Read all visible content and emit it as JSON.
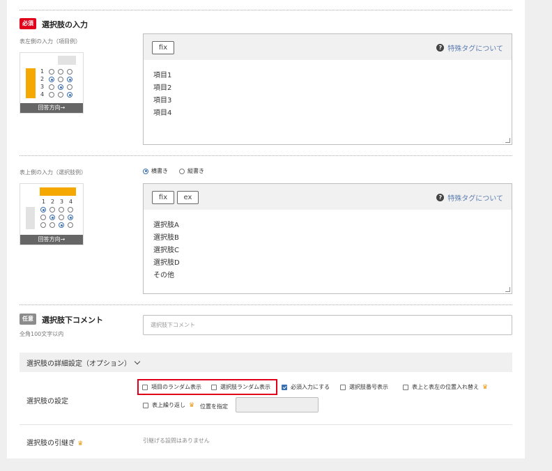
{
  "section1": {
    "badge": "必須",
    "badge_color": "#e0001b",
    "title": "選択肢の入力",
    "sublabel": "表左側の入力（項目例）",
    "illustration_numbers": [
      "1",
      "2",
      "3",
      "4"
    ],
    "illustration_footer": "回答方向→",
    "buttons": [
      "fix"
    ],
    "help_text": "特殊タグについて",
    "lines": [
      "項目1",
      "項目2",
      "項目3",
      "項目4"
    ]
  },
  "section2": {
    "sublabel": "表上側の入力（選択肢例）",
    "orientation_options": [
      {
        "label": "横書き",
        "checked": true
      },
      {
        "label": "縦書き",
        "checked": false
      }
    ],
    "illustration_numbers": [
      "1",
      "2",
      "3",
      "4"
    ],
    "illustration_footer": "回答方向→",
    "buttons": [
      "fix",
      "ex"
    ],
    "help_text": "特殊タグについて",
    "lines": [
      "選択肢A",
      "選択肢B",
      "選択肢C",
      "選択肢D",
      "その他"
    ]
  },
  "section3": {
    "badge": "任意",
    "badge_color": "#8c8c8c",
    "title": "選択肢下コメント",
    "sublabel": "全角100文字以内",
    "placeholder": "選択肢下コメント"
  },
  "details": {
    "toggle_label": "選択肢の詳細設定（オプション）",
    "settings_label": "選択肢の設定",
    "options": [
      {
        "label": "項目のランダム表示",
        "checked": false
      },
      {
        "label": "選択肢ランダム表示",
        "checked": false
      },
      {
        "label": "必須入力にする",
        "checked": true
      },
      {
        "label": "選択肢番号表示",
        "checked": false
      },
      {
        "label": "表上と表左の位置入れ替え",
        "checked": false,
        "premium": true
      }
    ],
    "repeat_option": {
      "label": "表上繰り返し",
      "checked": false,
      "premium": true
    },
    "position_label": "位置を指定",
    "carry_label": "選択肢の引継ぎ",
    "carry_text": "引継げる設問はありません"
  },
  "colors": {
    "accent": "#f5a800",
    "link": "#5a7cb0",
    "highlight": "#e0001b"
  }
}
